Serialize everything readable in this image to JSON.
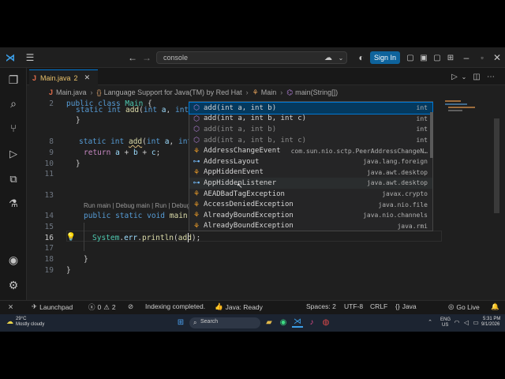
{
  "title_bar": {
    "command_center": "console",
    "sign_in": "Sign In"
  },
  "tab": {
    "filename": "Main.java",
    "problems": "2"
  },
  "breadcrumb": [
    "Main.java",
    "Language Support for Java(TM) by Red Hat",
    "Main",
    "main(String[])"
  ],
  "editor": {
    "code_lens": "Run main | Debug main | Run | Debug"
  },
  "suggestions": [
    {
      "label": "add(int a, int b)",
      "detail": "int",
      "kind": "method",
      "dim": false
    },
    {
      "label": "add(int a, int b, int c)",
      "detail": "int",
      "kind": "method",
      "dim": false
    },
    {
      "label": "add(int a, int b)",
      "detail": "int",
      "kind": "method",
      "dim": true
    },
    {
      "label": "add(int a, int b, int c)",
      "detail": "int",
      "kind": "method",
      "dim": true
    },
    {
      "label": "AddressChangeEvent",
      "detail": "com.sun.nio.sctp.PeerAddressChangeN…",
      "kind": "class",
      "dim": false
    },
    {
      "label": "AddressLayout",
      "detail": "java.lang.foreign",
      "kind": "interface",
      "dim": false
    },
    {
      "label": "AppHiddenEvent",
      "detail": "java.awt.desktop",
      "kind": "class",
      "dim": false
    },
    {
      "label": "AppHiddenListener",
      "detail": "java.awt.desktop",
      "kind": "interface",
      "dim": false
    },
    {
      "label": "AEADBadTagException",
      "detail": "javax.crypto",
      "kind": "class",
      "dim": false
    },
    {
      "label": "AccessDeniedException",
      "detail": "java.nio.file",
      "kind": "class",
      "dim": false
    },
    {
      "label": "AlreadyBoundException",
      "detail": "java.nio.channels",
      "kind": "class",
      "dim": false
    },
    {
      "label": "AlreadyBoundException",
      "detail": "java.rmi",
      "kind": "class",
      "dim": false
    }
  ],
  "status_bar": {
    "launchpad": "Launchpad",
    "errors": "0",
    "warnings": "2",
    "indexing": "Indexing completed.",
    "java_status": "Java: Ready",
    "spaces": "Spaces: 2",
    "encoding": "UTF-8",
    "eol": "CRLF",
    "language": "Java",
    "go_live": "Go Live"
  },
  "taskbar": {
    "weather_temp": "29°C",
    "weather_desc": "Mostly cloudy",
    "search_placeholder": "Search",
    "lang": "ENG",
    "region": "US",
    "time": "5:31 PM",
    "date": "9/1/2026"
  },
  "colors": {
    "accent": "#0078d4",
    "editor_bg": "#1f1f1f",
    "sign_in_bg": "#0e639c"
  }
}
